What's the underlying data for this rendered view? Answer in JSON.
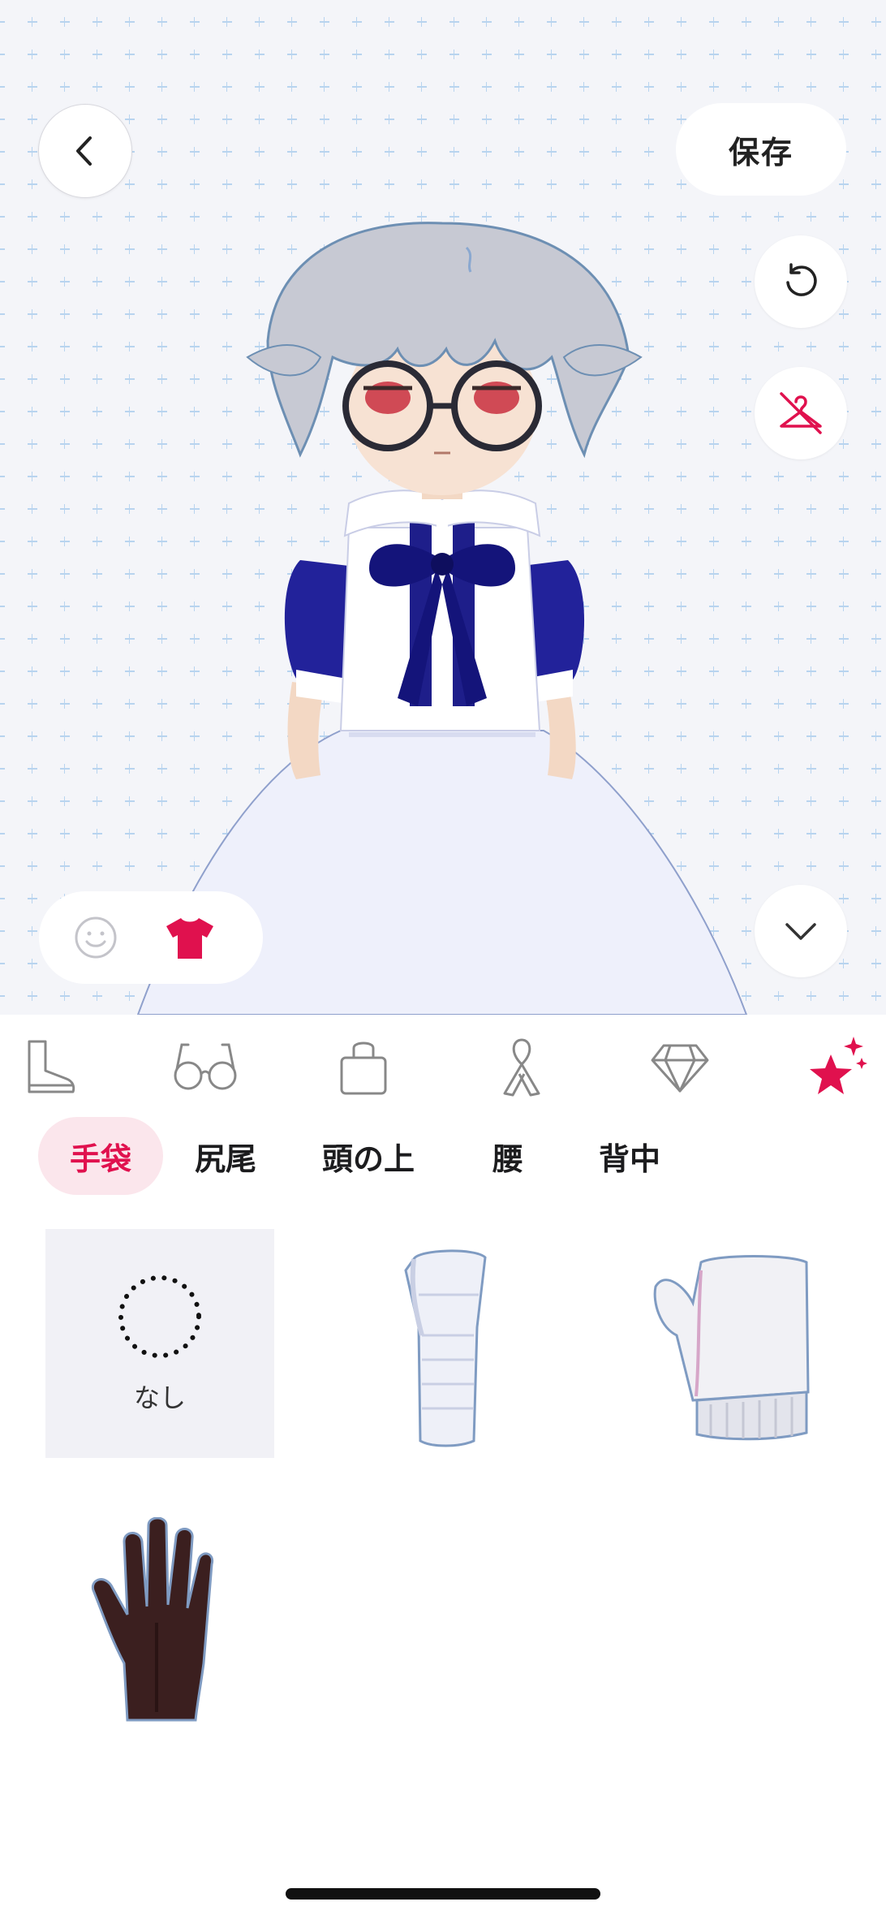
{
  "header": {
    "save_label": "保存",
    "back_icon": "chevron-left-icon",
    "reset_icon": "undo-icon",
    "hide_outfit_icon": "hanger-off-icon",
    "collapse_icon": "chevron-down-icon"
  },
  "mode_toggle": [
    {
      "name": "face",
      "icon": "smile-icon",
      "active": false
    },
    {
      "name": "outfit",
      "icon": "tshirt-icon",
      "active": true
    }
  ],
  "categories": [
    {
      "icon": "boot-icon",
      "active": false
    },
    {
      "icon": "glasses-icon",
      "active": false
    },
    {
      "icon": "bag-icon",
      "active": false
    },
    {
      "icon": "ribbon-icon",
      "active": false
    },
    {
      "icon": "diamond-icon",
      "active": false
    },
    {
      "icon": "sparkle-star-icon",
      "active": true
    }
  ],
  "subtabs": [
    {
      "label": "手袋",
      "active": true
    },
    {
      "label": "尻尾",
      "active": false
    },
    {
      "label": "頭の上",
      "active": false
    },
    {
      "label": "腰",
      "active": false
    },
    {
      "label": "背中",
      "active": false
    }
  ],
  "items": {
    "none_label": "なし",
    "list": [
      {
        "name": "none",
        "selected": true
      },
      {
        "name": "white-arm-sleeve",
        "selected": false
      },
      {
        "name": "white-fur-fingerless-mitten",
        "selected": false
      },
      {
        "name": "dark-brown-glove",
        "selected": false
      }
    ]
  },
  "colors": {
    "accent": "#e0114e",
    "active_tab_bg": "#fbe6ec",
    "preview_bg": "#f4f5f9",
    "grid_cross": "#b8d4ef"
  }
}
